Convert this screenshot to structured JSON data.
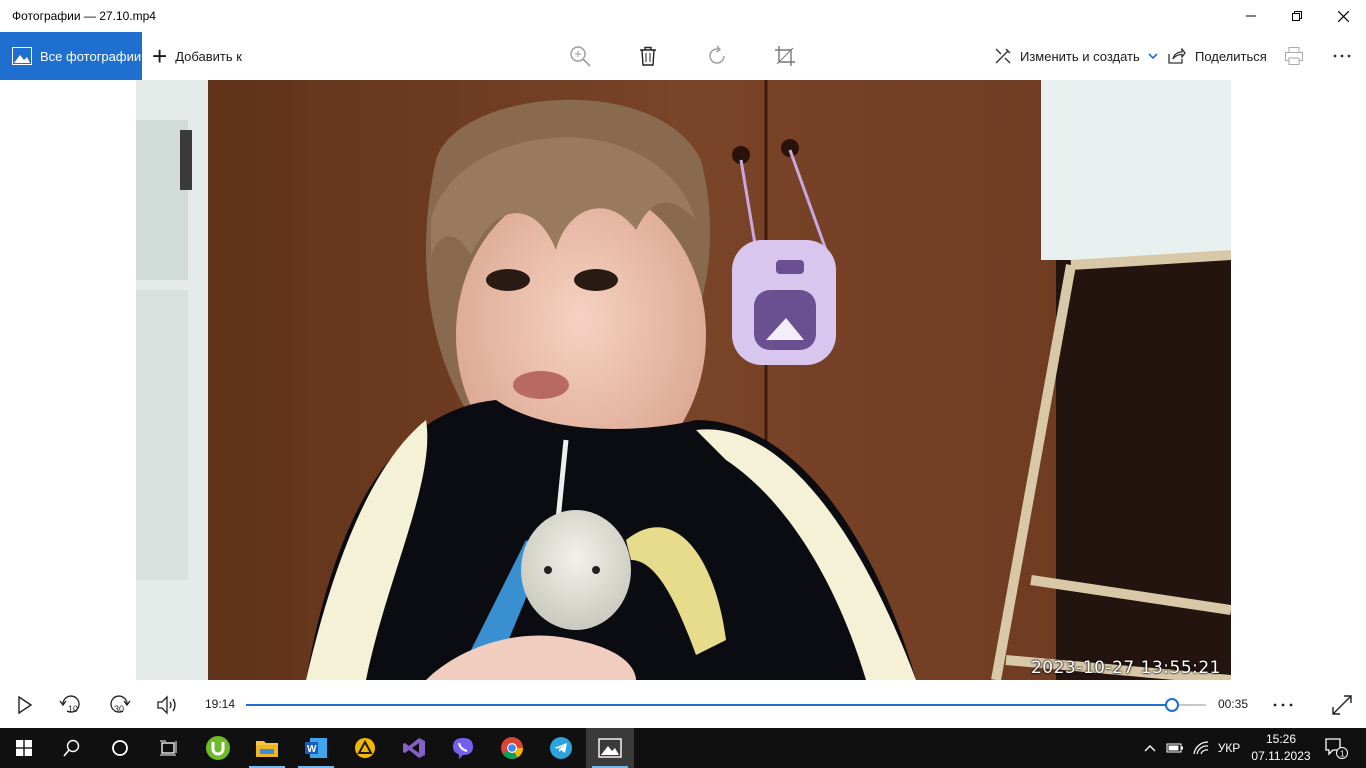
{
  "window": {
    "title": "Фотографии — 27.10.mp4",
    "minimize_icon": "minimize-icon",
    "restore_icon": "restore-icon",
    "close_icon": "close-icon"
  },
  "toolbar": {
    "all_photos_label": "Все фотографии",
    "add_to_label": "Добавить к",
    "edit_create_label": "Изменить и создать",
    "share_label": "Поделиться",
    "icons": [
      "zoom-icon",
      "delete-icon",
      "rotate-icon",
      "crop-icon",
      "print-icon",
      "more-icon"
    ],
    "accent_color": "#1f6fd0"
  },
  "video": {
    "timestamp_overlay": "2023-10-27  13:55:21"
  },
  "playback": {
    "elapsed": "19:14",
    "remaining": "00:35",
    "progress_fraction": 0.965,
    "skip_back_label": "10",
    "skip_forward_label": "30"
  },
  "taskbar": {
    "apps": [
      "utorrent",
      "file-explorer",
      "word",
      "app-triangle",
      "visual-studio",
      "viber",
      "chrome",
      "telegram",
      "photos"
    ],
    "language": "УКР",
    "time": "15:26",
    "date": "07.11.2023",
    "notification_count": "1"
  }
}
